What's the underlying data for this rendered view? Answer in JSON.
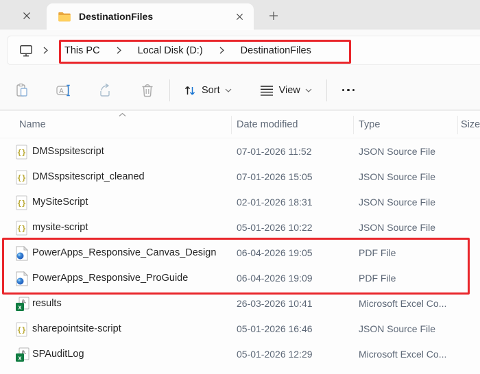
{
  "tab_bar": {
    "active_tab_title": "DestinationFiles"
  },
  "address_bar": {
    "breadcrumbs": [
      "This PC",
      "Local Disk (D:)",
      "DestinationFiles"
    ]
  },
  "toolbar": {
    "sort_label": "Sort",
    "view_label": "View"
  },
  "list": {
    "columns": [
      "Name",
      "Date modified",
      "Type",
      "Size"
    ]
  },
  "files": [
    {
      "name": "DMSspsitescript",
      "date_modified": "07-01-2026 11:52",
      "type": "JSON Source File",
      "icon": "json-file-icon"
    },
    {
      "name": "DMSspsitescript_cleaned",
      "date_modified": "07-01-2026 15:05",
      "type": "JSON Source File",
      "icon": "json-file-icon"
    },
    {
      "name": "MySiteScript",
      "date_modified": "02-01-2026 18:31",
      "type": "JSON Source File",
      "icon": "json-file-icon"
    },
    {
      "name": "mysite-script",
      "date_modified": "05-01-2026 10:22",
      "type": "JSON Source File",
      "icon": "json-file-icon"
    },
    {
      "name": "PowerApps_Responsive_Canvas_Design",
      "date_modified": "06-04-2026 19:05",
      "type": "PDF File",
      "icon": "pdf-file-icon",
      "highlighted": true
    },
    {
      "name": "PowerApps_Responsive_ProGuide",
      "date_modified": "06-04-2026 19:09",
      "type": "PDF File",
      "icon": "pdf-file-icon",
      "highlighted": true
    },
    {
      "name": "results",
      "date_modified": "26-03-2026 10:41",
      "type": "Microsoft Excel Co...",
      "icon": "excel-csv-file-icon"
    },
    {
      "name": "sharepointsite-script",
      "date_modified": "05-01-2026 16:46",
      "type": "JSON Source File",
      "icon": "json-file-icon"
    },
    {
      "name": "SPAuditLog",
      "date_modified": "05-01-2026 12:29",
      "type": "Microsoft Excel Co...",
      "icon": "excel-csv-file-icon"
    }
  ],
  "icons": [
    "close-icon",
    "folder-icon",
    "plus-icon",
    "monitor-icon",
    "chevron-right-icon",
    "paste-icon",
    "rename-icon",
    "share-icon",
    "delete-icon",
    "sort-icon",
    "view-icon",
    "chevron-down-icon",
    "more-options-icon",
    "sort-ascending-caret-icon",
    "json-file-icon",
    "pdf-file-icon",
    "excel-csv-file-icon"
  ],
  "colors": {
    "annotation_red": "#e9262b",
    "accent_blue": "#1673d1",
    "folder_yellow": "#ffd05f",
    "excel_green": "#107c41"
  }
}
